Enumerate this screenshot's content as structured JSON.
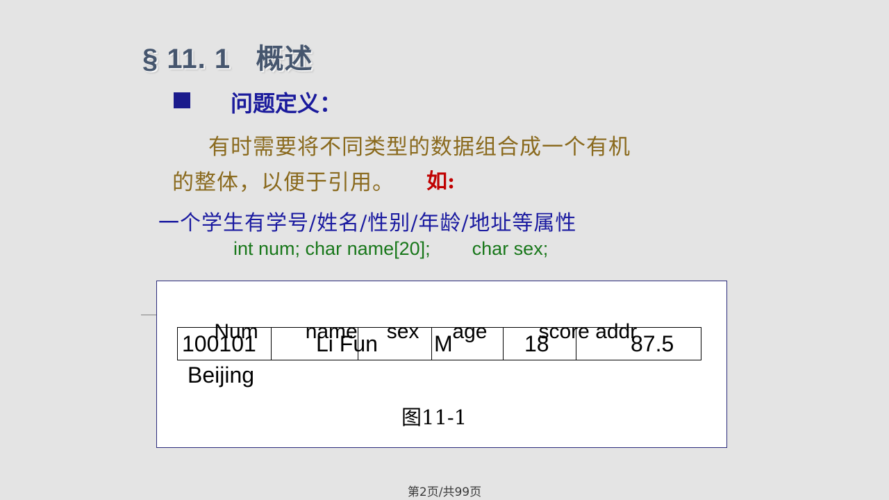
{
  "slide": {
    "title": "§ 11. 1   概述",
    "bullet": {
      "icon": "square-bullet",
      "label": "问题定义："
    },
    "paragraph": {
      "line1": "有时需要将不同类型的数据组合成一个有机",
      "line2": "的整体，以便于引用。",
      "emphasis": "如:"
    },
    "attribute_line": "一个学生有学号/姓名/性别/年龄/地址等属性",
    "code_line": "int num; char name[20];        char sex;",
    "figure": {
      "caption_cjk": "图",
      "caption_num": "11-1",
      "headers": [
        "Num",
        "name",
        "sex",
        "age",
        "score",
        "addr"
      ],
      "row": {
        "num": "100101",
        "name": "Li Fun",
        "sex": "M",
        "age": "18",
        "score": "87.5",
        "addr": "Beijing"
      }
    }
  },
  "footer": {
    "page_text": "第2页/共99页"
  },
  "colors": {
    "background": "#e4e4e4",
    "title": "#46566e",
    "bullet_navy": "#1a1a9c",
    "body_brown": "#8a6a1e",
    "emphasis_red": "#c00000",
    "attribute_blue": "#1a1aa0",
    "code_green": "#18771a",
    "figure_border": "#2a2a7a",
    "table_border": "#000000",
    "footer_text": "#3a3a3a"
  }
}
